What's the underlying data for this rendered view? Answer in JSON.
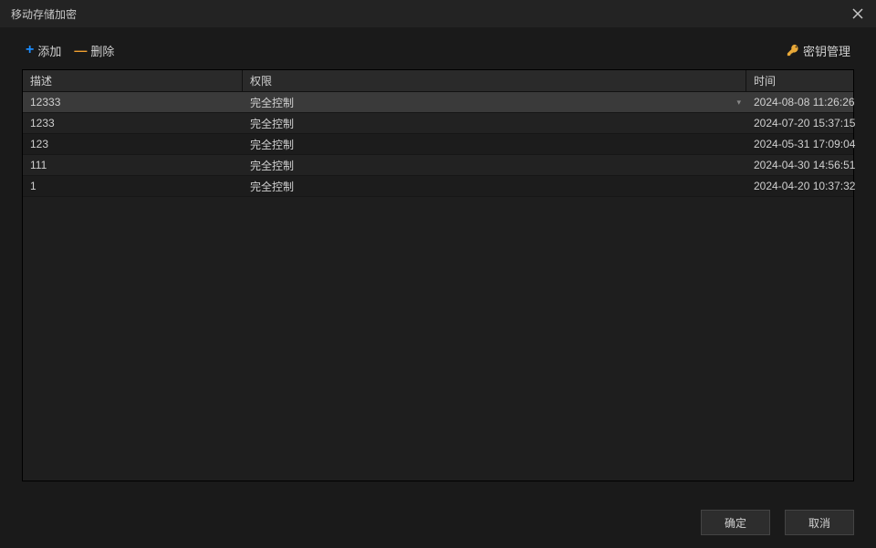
{
  "titlebar": {
    "title": "移动存储加密"
  },
  "toolbar": {
    "add_label": "添加",
    "delete_label": "删除",
    "key_mgmt_label": "密钥管理"
  },
  "table": {
    "headers": {
      "desc": "描述",
      "perm": "权限",
      "time": "时间"
    },
    "rows": [
      {
        "desc": "12333",
        "perm": "完全控制",
        "time": "2024-08-08 11:26:26",
        "selected": true,
        "has_dropdown": true
      },
      {
        "desc": "1233",
        "perm": "完全控制",
        "time": "2024-07-20 15:37:15",
        "selected": false
      },
      {
        "desc": "123",
        "perm": "完全控制",
        "time": "2024-05-31 17:09:04",
        "selected": false
      },
      {
        "desc": "111",
        "perm": "完全控制",
        "time": "2024-04-30 14:56:51",
        "selected": false
      },
      {
        "desc": "1",
        "perm": "完全控制",
        "time": "2024-04-20 10:37:32",
        "selected": false
      }
    ]
  },
  "footer": {
    "ok_label": "确定",
    "cancel_label": "取消"
  }
}
